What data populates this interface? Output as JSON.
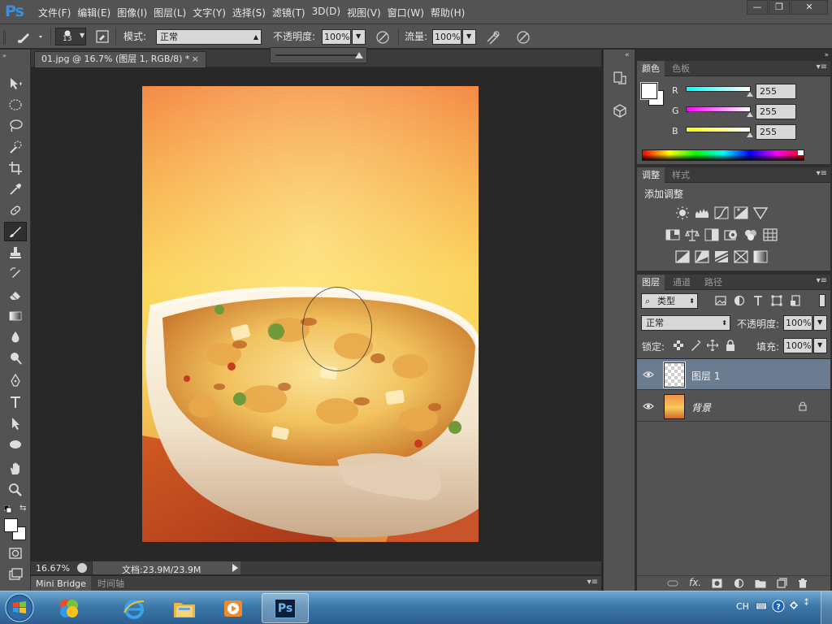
{
  "app": {
    "logo": "Ps",
    "menu": [
      "文件(F)",
      "编辑(E)",
      "图像(I)",
      "图层(L)",
      "文字(Y)",
      "选择(S)",
      "滤镜(T)",
      "3D(D)",
      "视图(V)",
      "窗口(W)",
      "帮助(H)"
    ],
    "window_buttons": {
      "minimize": "—",
      "restore": "❐",
      "close": "✕"
    }
  },
  "options_bar": {
    "brush_size": "13",
    "mode_label": "模式:",
    "mode_value": "正常",
    "opacity_label": "不透明度:",
    "opacity_value": "100%",
    "flow_label": "流量:",
    "flow_value": "100%"
  },
  "document": {
    "tab_title": "01.jpg @ 16.7% (图层 1, RGB/8) *",
    "tab_close": "×",
    "zoom": "16.67%",
    "doc_info": "文档:23.9M/23.9M"
  },
  "bottom_tabs": [
    "Mini Bridge",
    "时间轴"
  ],
  "color_panel": {
    "tabs": [
      "颜色",
      "色板"
    ],
    "channels": [
      {
        "label": "R",
        "value": "255"
      },
      {
        "label": "G",
        "value": "255"
      },
      {
        "label": "B",
        "value": "255"
      }
    ]
  },
  "adjustments_panel": {
    "tabs": [
      "调整",
      "样式"
    ],
    "heading": "添加调整",
    "icons_row1": [
      "brightness-icon",
      "levels-icon",
      "curves-icon",
      "exposure-icon",
      "gradient-triangle-icon"
    ],
    "icons_row2": [
      "vibrance-icon",
      "color-balance-icon",
      "black-white-icon",
      "photo-filter-icon",
      "channel-mixer-icon",
      "color-lookup-icon"
    ],
    "icons_row3": [
      "invert-icon",
      "posterize-icon",
      "threshold-icon",
      "selective-color-icon",
      "gradient-map-icon"
    ]
  },
  "layers_panel": {
    "tabs": [
      "图层",
      "通道",
      "路径"
    ],
    "filter_kind": "类型",
    "blend_mode": "正常",
    "opacity_label": "不透明度:",
    "opacity_value": "100%",
    "lock_label": "锁定:",
    "fill_label": "填充:",
    "fill_value": "100%",
    "layers": [
      {
        "name": "图层 1",
        "selected": true
      },
      {
        "name": "背景",
        "selected": false
      }
    ],
    "footer_fx": "fx."
  },
  "taskbar": {
    "language": "CH",
    "apps": [
      "start-orb",
      "media-center",
      "internet-explorer",
      "file-explorer",
      "media-player",
      "photoshop"
    ],
    "active_app": "photoshop",
    "ps_label": "Ps"
  },
  "colors": {
    "accent": "#3e8ed8",
    "panel_bg": "#535353",
    "dark_bg": "#282828",
    "layer_selected": "#6b7b90"
  }
}
